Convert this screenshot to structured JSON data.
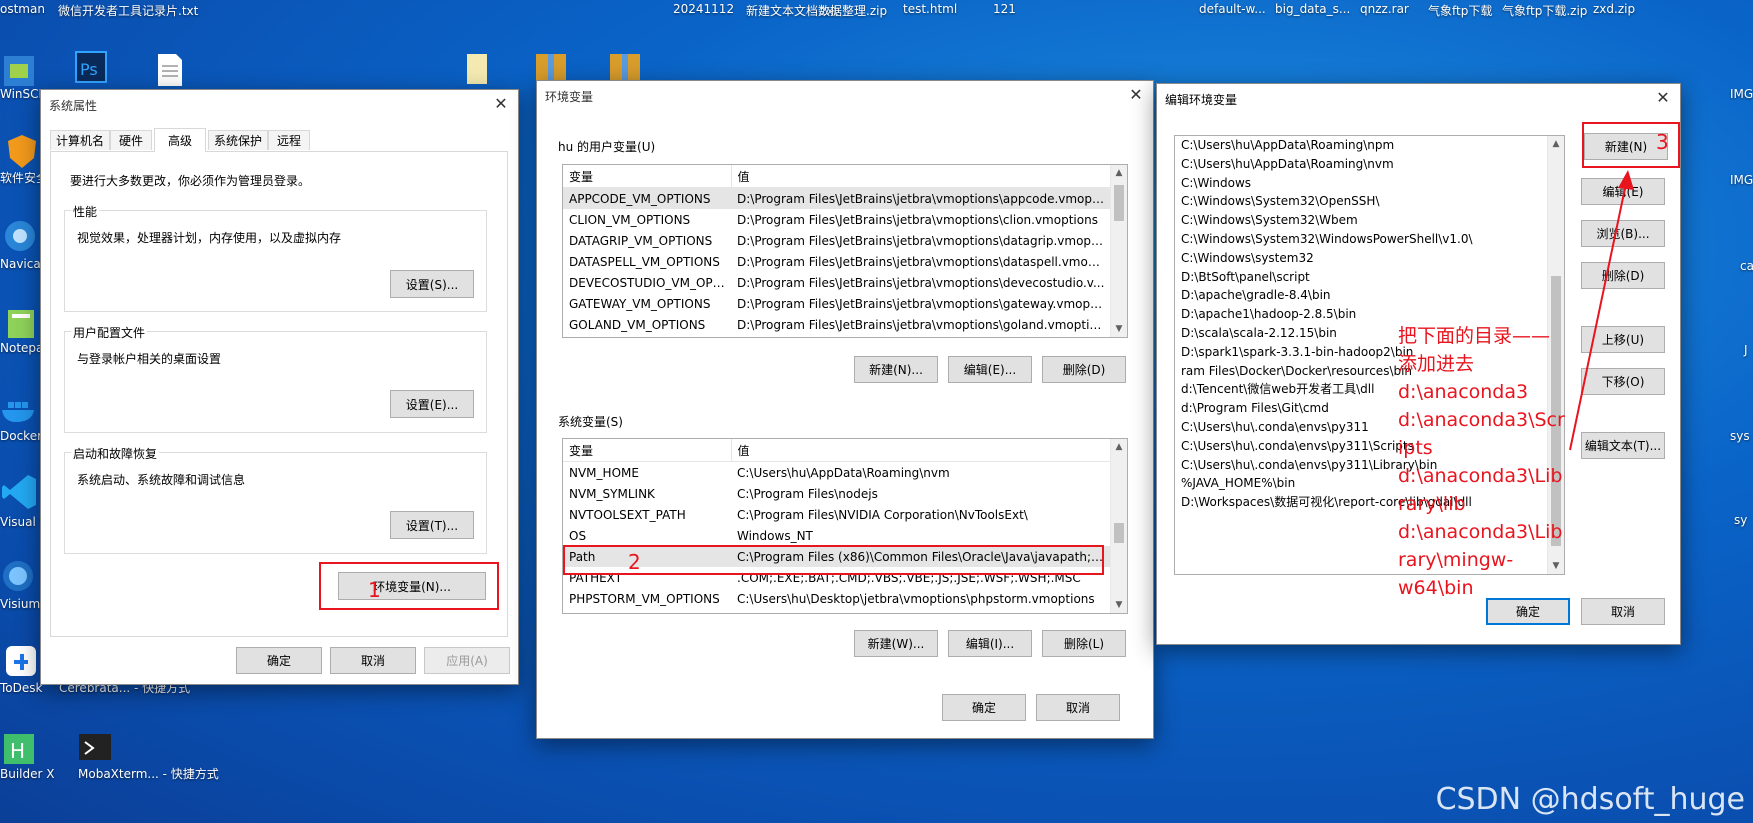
{
  "desktop": {
    "top_labels": [
      "ostman",
      "微信开发者工具",
      "记录片.txt",
      "20241112",
      "新建文本文档.txt",
      "数据整理.zip",
      "test.html",
      "121",
      "default-w...",
      "big_data_s...",
      "qnzz.rar",
      "气象ftp下载",
      "气象ftp下载.zip",
      "zxd.zip"
    ],
    "left_labels": [
      "WinSCP",
      "软件安全软",
      "Navicat Premium",
      "Notepad++",
      "Docker Desktop",
      "Visual Studio Code",
      "Visiumlab",
      "ToDesk",
      "Builder X"
    ],
    "second_col_labels": [
      "Cerebrata... - 快捷方式",
      "MobaXterm... - 快捷方式"
    ],
    "right_labels": [
      "IMG",
      "IMG",
      "ca",
      "J",
      "sys",
      "sy"
    ]
  },
  "sys_props": {
    "title": "系统属性",
    "tabs": [
      "计算机名",
      "硬件",
      "高级",
      "系统保护",
      "远程"
    ],
    "active_tab": "高级",
    "admin_note": "要进行大多数更改，你必须作为管理员登录。",
    "groups": [
      {
        "title": "性能",
        "desc": "视觉效果，处理器计划，内存使用，以及虚拟内存",
        "button": "设置(S)..."
      },
      {
        "title": "用户配置文件",
        "desc": "与登录帐户相关的桌面设置",
        "button": "设置(E)..."
      },
      {
        "title": "启动和故障恢复",
        "desc": "系统启动、系统故障和调试信息",
        "button": "设置(T)..."
      }
    ],
    "env_button": "环境变量(N)...",
    "ok": "确定",
    "cancel": "取消",
    "apply": "应用(A)"
  },
  "env_vars": {
    "title": "环境变量",
    "user_section": "hu 的用户变量(U)",
    "col_var": "变量",
    "col_val": "值",
    "user_vars": [
      {
        "name": "APPCODE_VM_OPTIONS",
        "value": "D:\\Program Files\\JetBrains\\jetbra\\vmoptions\\appcode.vmopt..."
      },
      {
        "name": "CLION_VM_OPTIONS",
        "value": "D:\\Program Files\\JetBrains\\jetbra\\vmoptions\\clion.vmoptions"
      },
      {
        "name": "DATAGRIP_VM_OPTIONS",
        "value": "D:\\Program Files\\JetBrains\\jetbra\\vmoptions\\datagrip.vmopti..."
      },
      {
        "name": "DATASPELL_VM_OPTIONS",
        "value": "D:\\Program Files\\JetBrains\\jetbra\\vmoptions\\dataspell.vmopt..."
      },
      {
        "name": "DEVECOSTUDIO_VM_OPT...",
        "value": "D:\\Program Files\\JetBrains\\jetbra\\vmoptions\\devecostudio.v..."
      },
      {
        "name": "GATEWAY_VM_OPTIONS",
        "value": "D:\\Program Files\\JetBrains\\jetbra\\vmoptions\\gateway.vmopti..."
      },
      {
        "name": "GOLAND_VM_OPTIONS",
        "value": "D:\\Program Files\\JetBrains\\jetbra\\vmoptions\\goland.vmoptio..."
      }
    ],
    "user_buttons": [
      "新建(N)...",
      "编辑(E)...",
      "删除(D)"
    ],
    "system_section": "系统变量(S)",
    "system_vars": [
      {
        "name": "NVM_HOME",
        "value": "C:\\Users\\hu\\AppData\\Roaming\\nvm"
      },
      {
        "name": "NVM_SYMLINK",
        "value": "C:\\Program Files\\nodejs"
      },
      {
        "name": "NVTOOLSEXT_PATH",
        "value": "C:\\Program Files\\NVIDIA Corporation\\NvToolsExt\\"
      },
      {
        "name": "OS",
        "value": "Windows_NT"
      },
      {
        "name": "Path",
        "value": "C:\\Program Files (x86)\\Common Files\\Oracle\\Java\\javapath;C:..."
      },
      {
        "name": "PATHEXT",
        "value": ".COM;.EXE;.BAT;.CMD;.VBS;.VBE;.JS;.JSE;.WSF;.WSH;.MSC"
      },
      {
        "name": "PHPSTORM_VM_OPTIONS",
        "value": "C:\\Users\\hu\\Desktop\\jetbra\\vmoptions\\phpstorm.vmoptions"
      }
    ],
    "system_buttons": [
      "新建(W)...",
      "编辑(I)...",
      "删除(L)"
    ],
    "ok": "确定",
    "cancel": "取消"
  },
  "edit_env": {
    "title": "编辑环境变量",
    "items": [
      "C:\\Users\\hu\\AppData\\Roaming\\npm",
      "C:\\Users\\hu\\AppData\\Roaming\\nvm",
      "C:\\Windows",
      "C:\\Windows\\System32\\OpenSSH\\",
      "C:\\Windows\\System32\\Wbem",
      "C:\\Windows\\System32\\WindowsPowerShell\\v1.0\\",
      "C:\\Windows\\system32",
      "D:\\BtSoft\\panel\\script",
      "D:\\apache\\gradle-8.4\\bin",
      "D:\\apache1\\hadoop-2.8.5\\bin",
      "D:\\scala\\scala-2.12.15\\bin",
      "D:\\spark1\\spark-3.3.1-bin-hadoop2\\bin",
      "ram Files\\Docker\\Docker\\resources\\bin",
      "d:\\Tencent\\微信web开发者工具\\dll",
      "d:\\Program Files\\Git\\cmd",
      "C:\\Users\\hu\\.conda\\envs\\py311",
      "C:\\Users\\hu\\.conda\\envs\\py311\\Scripts",
      "C:\\Users\\hu\\.conda\\envs\\py311\\Library\\bin",
      "%JAVA_HOME%\\bin",
      "D:\\Workspaces\\数据可视化\\report-core\\lib\\gdal\\dll"
    ],
    "buttons": [
      "新建(N)",
      "编辑(E)",
      "浏览(B)...",
      "删除(D)",
      "上移(U)",
      "下移(O)",
      "编辑文本(T)..."
    ],
    "ok": "确定",
    "cancel": "取消"
  },
  "annotations": {
    "step1": "1",
    "step2": "2",
    "step3": "3",
    "note_lines": [
      "把下面的目录——",
      "添加进去",
      "d:\\anaconda3",
      "d:\\anaconda3\\Scr",
      "ipts",
      "d:\\anaconda3\\Lib",
      "rary\\lib",
      "d:\\anaconda3\\Lib",
      "rary\\mingw-",
      "w64\\bin"
    ],
    "color": "#e8141e"
  },
  "watermark": "CSDN @hdsoft_huge"
}
